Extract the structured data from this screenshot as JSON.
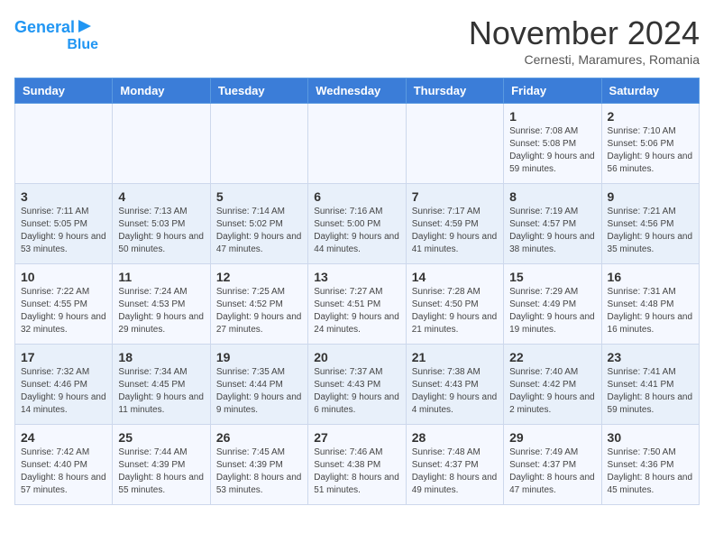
{
  "header": {
    "logo_line1": "General",
    "logo_line2": "Blue",
    "month": "November 2024",
    "location": "Cernesti, Maramures, Romania"
  },
  "weekdays": [
    "Sunday",
    "Monday",
    "Tuesday",
    "Wednesday",
    "Thursday",
    "Friday",
    "Saturday"
  ],
  "rows": [
    [
      {
        "day": "",
        "info": ""
      },
      {
        "day": "",
        "info": ""
      },
      {
        "day": "",
        "info": ""
      },
      {
        "day": "",
        "info": ""
      },
      {
        "day": "",
        "info": ""
      },
      {
        "day": "1",
        "info": "Sunrise: 7:08 AM\nSunset: 5:08 PM\nDaylight: 9 hours and 59 minutes."
      },
      {
        "day": "2",
        "info": "Sunrise: 7:10 AM\nSunset: 5:06 PM\nDaylight: 9 hours and 56 minutes."
      }
    ],
    [
      {
        "day": "3",
        "info": "Sunrise: 7:11 AM\nSunset: 5:05 PM\nDaylight: 9 hours and 53 minutes."
      },
      {
        "day": "4",
        "info": "Sunrise: 7:13 AM\nSunset: 5:03 PM\nDaylight: 9 hours and 50 minutes."
      },
      {
        "day": "5",
        "info": "Sunrise: 7:14 AM\nSunset: 5:02 PM\nDaylight: 9 hours and 47 minutes."
      },
      {
        "day": "6",
        "info": "Sunrise: 7:16 AM\nSunset: 5:00 PM\nDaylight: 9 hours and 44 minutes."
      },
      {
        "day": "7",
        "info": "Sunrise: 7:17 AM\nSunset: 4:59 PM\nDaylight: 9 hours and 41 minutes."
      },
      {
        "day": "8",
        "info": "Sunrise: 7:19 AM\nSunset: 4:57 PM\nDaylight: 9 hours and 38 minutes."
      },
      {
        "day": "9",
        "info": "Sunrise: 7:21 AM\nSunset: 4:56 PM\nDaylight: 9 hours and 35 minutes."
      }
    ],
    [
      {
        "day": "10",
        "info": "Sunrise: 7:22 AM\nSunset: 4:55 PM\nDaylight: 9 hours and 32 minutes."
      },
      {
        "day": "11",
        "info": "Sunrise: 7:24 AM\nSunset: 4:53 PM\nDaylight: 9 hours and 29 minutes."
      },
      {
        "day": "12",
        "info": "Sunrise: 7:25 AM\nSunset: 4:52 PM\nDaylight: 9 hours and 27 minutes."
      },
      {
        "day": "13",
        "info": "Sunrise: 7:27 AM\nSunset: 4:51 PM\nDaylight: 9 hours and 24 minutes."
      },
      {
        "day": "14",
        "info": "Sunrise: 7:28 AM\nSunset: 4:50 PM\nDaylight: 9 hours and 21 minutes."
      },
      {
        "day": "15",
        "info": "Sunrise: 7:29 AM\nSunset: 4:49 PM\nDaylight: 9 hours and 19 minutes."
      },
      {
        "day": "16",
        "info": "Sunrise: 7:31 AM\nSunset: 4:48 PM\nDaylight: 9 hours and 16 minutes."
      }
    ],
    [
      {
        "day": "17",
        "info": "Sunrise: 7:32 AM\nSunset: 4:46 PM\nDaylight: 9 hours and 14 minutes."
      },
      {
        "day": "18",
        "info": "Sunrise: 7:34 AM\nSunset: 4:45 PM\nDaylight: 9 hours and 11 minutes."
      },
      {
        "day": "19",
        "info": "Sunrise: 7:35 AM\nSunset: 4:44 PM\nDaylight: 9 hours and 9 minutes."
      },
      {
        "day": "20",
        "info": "Sunrise: 7:37 AM\nSunset: 4:43 PM\nDaylight: 9 hours and 6 minutes."
      },
      {
        "day": "21",
        "info": "Sunrise: 7:38 AM\nSunset: 4:43 PM\nDaylight: 9 hours and 4 minutes."
      },
      {
        "day": "22",
        "info": "Sunrise: 7:40 AM\nSunset: 4:42 PM\nDaylight: 9 hours and 2 minutes."
      },
      {
        "day": "23",
        "info": "Sunrise: 7:41 AM\nSunset: 4:41 PM\nDaylight: 8 hours and 59 minutes."
      }
    ],
    [
      {
        "day": "24",
        "info": "Sunrise: 7:42 AM\nSunset: 4:40 PM\nDaylight: 8 hours and 57 minutes."
      },
      {
        "day": "25",
        "info": "Sunrise: 7:44 AM\nSunset: 4:39 PM\nDaylight: 8 hours and 55 minutes."
      },
      {
        "day": "26",
        "info": "Sunrise: 7:45 AM\nSunset: 4:39 PM\nDaylight: 8 hours and 53 minutes."
      },
      {
        "day": "27",
        "info": "Sunrise: 7:46 AM\nSunset: 4:38 PM\nDaylight: 8 hours and 51 minutes."
      },
      {
        "day": "28",
        "info": "Sunrise: 7:48 AM\nSunset: 4:37 PM\nDaylight: 8 hours and 49 minutes."
      },
      {
        "day": "29",
        "info": "Sunrise: 7:49 AM\nSunset: 4:37 PM\nDaylight: 8 hours and 47 minutes."
      },
      {
        "day": "30",
        "info": "Sunrise: 7:50 AM\nSunset: 4:36 PM\nDaylight: 8 hours and 45 minutes."
      }
    ]
  ]
}
